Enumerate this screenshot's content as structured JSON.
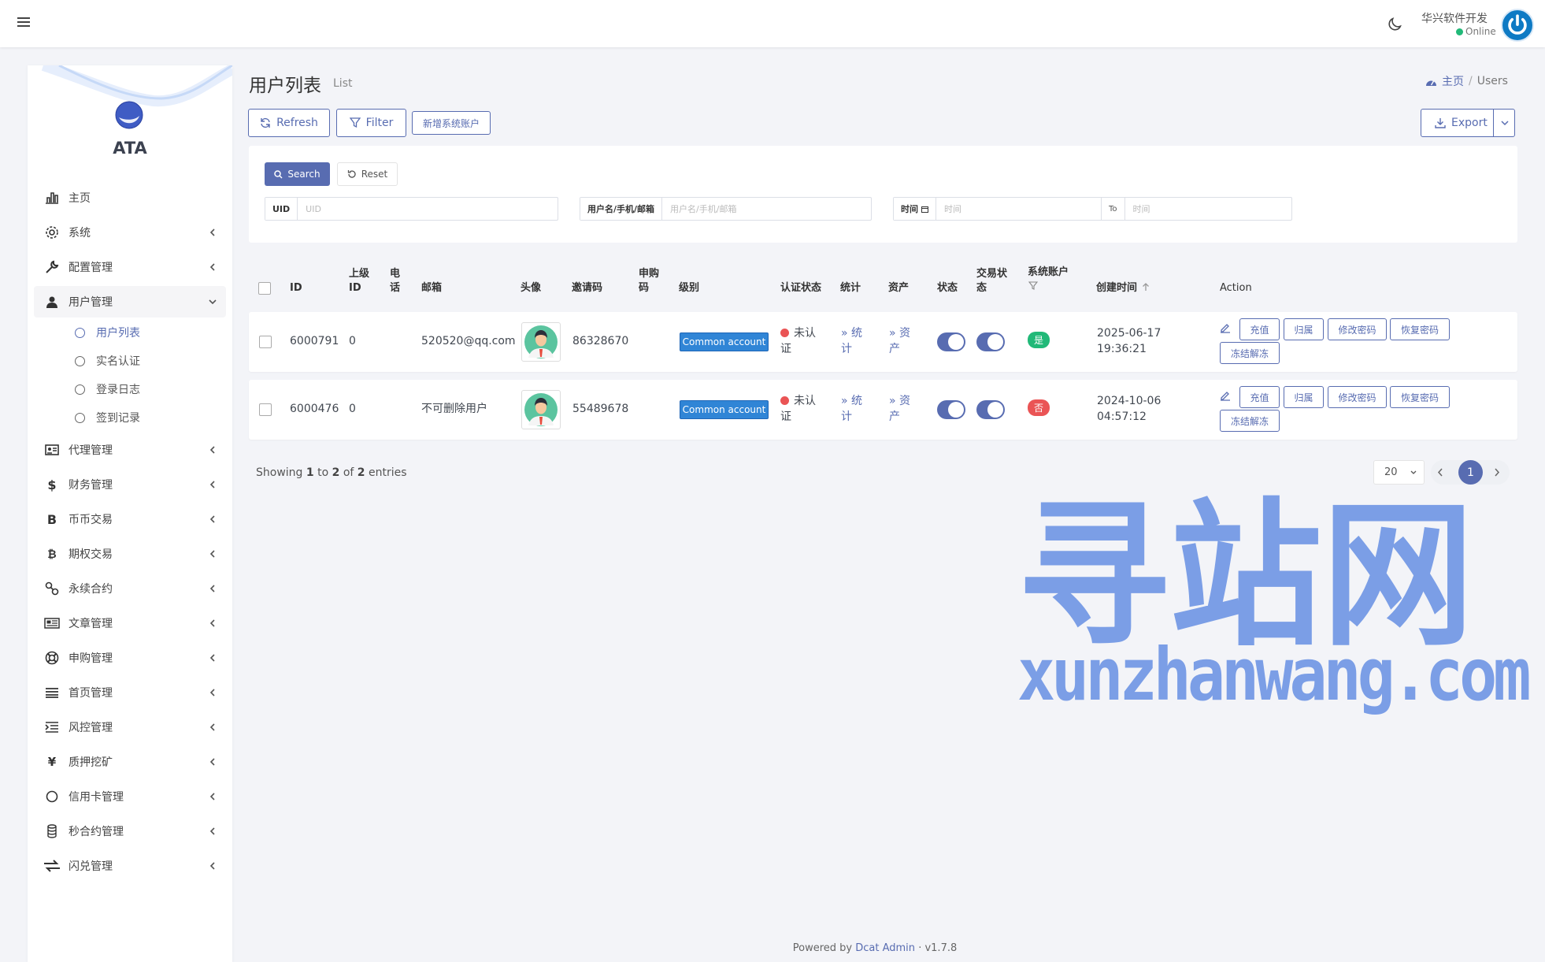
{
  "topbar": {
    "user_name": "华兴软件开发",
    "user_status": "Online"
  },
  "brand": {
    "name": "ATA"
  },
  "sidebar": {
    "items": [
      {
        "label": "主页",
        "icon": "bar-chart-icon"
      },
      {
        "label": "系统",
        "icon": "gear-icon"
      },
      {
        "label": "配置管理",
        "icon": "wrench-icon"
      },
      {
        "label": "用户管理",
        "icon": "user-secret-icon"
      },
      {
        "label": "代理管理",
        "icon": "id-card-icon"
      },
      {
        "label": "财务管理",
        "icon": "dollar-icon"
      },
      {
        "label": "币币交易",
        "icon": "bitcoin-b-icon"
      },
      {
        "label": "期权交易",
        "icon": "bitcoin-icon"
      },
      {
        "label": "永续合约",
        "icon": "link-icon"
      },
      {
        "label": "文章管理",
        "icon": "newspaper-icon"
      },
      {
        "label": "申购管理",
        "icon": "life-ring-icon"
      },
      {
        "label": "首页管理",
        "icon": "list-lines-icon"
      },
      {
        "label": "风控管理",
        "icon": "indent-icon"
      },
      {
        "label": "质押挖矿",
        "icon": "yen-icon"
      },
      {
        "label": "信用卡管理",
        "icon": "circle-icon"
      },
      {
        "label": "秒合约管理",
        "icon": "coins-icon"
      },
      {
        "label": "闪兑管理",
        "icon": "exchange-icon"
      }
    ],
    "sub_items": [
      {
        "label": "用户列表"
      },
      {
        "label": "实名认证"
      },
      {
        "label": "登录日志"
      },
      {
        "label": "签到记录"
      }
    ]
  },
  "page": {
    "title": "用户列表",
    "subtitle": "List"
  },
  "breadcrumb": {
    "home": "主页",
    "separator": "/",
    "current": "Users"
  },
  "toolbar": {
    "refresh": "Refresh",
    "filter": "Filter",
    "add_system": "新增系统账户",
    "export": "Export"
  },
  "filters": {
    "search": "Search",
    "reset": "Reset",
    "uid_label": "UID",
    "uid_placeholder": "UID",
    "user_label": "用户名/手机/邮箱",
    "user_placeholder": "用户名/手机/邮箱",
    "time_label": "时间",
    "time_placeholder": "时间",
    "to_label": "To",
    "to_placeholder": "时间"
  },
  "table": {
    "headers": {
      "id": "ID",
      "parent_id_1": "上级",
      "parent_id_2": "ID",
      "phone_1": "电",
      "phone_2": "话",
      "email": "邮箱",
      "avatar": "头像",
      "invite": "邀请码",
      "purchase_1": "申购",
      "purchase_2": "码",
      "level": "级别",
      "auth": "认证状态",
      "stats": "统计",
      "assets": "资产",
      "status": "状态",
      "trade_1": "交易状",
      "trade_2": "态",
      "sys_acct": "系统账户",
      "created": "创建时间",
      "action": "Action"
    },
    "rows": [
      {
        "id": "6000791",
        "parent_id": "0",
        "email": "520520@qq.com",
        "invite": "86328670",
        "level": "Common account",
        "auth_1": "未认",
        "auth_2": "证",
        "stats_1": "» 统",
        "stats_2": "计",
        "assets_1": "» 资",
        "assets_2": "产",
        "sys": "是",
        "date": "2025-06-17",
        "time": "19:36:21",
        "actions": {
          "recharge": "充值",
          "belong": "归属",
          "change_pwd": "修改密码",
          "restore_pwd": "恢复密码",
          "freeze": "冻结解冻"
        }
      },
      {
        "id": "6000476",
        "parent_id": "0",
        "email": "不可删除用户",
        "invite": "55489678",
        "level": "Common account",
        "auth_1": "未认",
        "auth_2": "证",
        "stats_1": "» 统",
        "stats_2": "计",
        "assets_1": "» 资",
        "assets_2": "产",
        "sys": "否",
        "date": "2024-10-06",
        "time": "04:57:12",
        "actions": {
          "recharge": "充值",
          "belong": "归属",
          "change_pwd": "修改密码",
          "restore_pwd": "恢复密码",
          "freeze": "冻结解冻"
        }
      }
    ]
  },
  "pagination": {
    "showing_prefix": "Showing",
    "from": "1",
    "to_word": "to",
    "to": "2",
    "of_word": "of",
    "total": "2",
    "entries": "entries",
    "per_page": "20",
    "current_page": "1"
  },
  "footer": {
    "powered": "Powered by",
    "link": "Dcat Admin",
    "sep": "·",
    "version": "v1.7.8"
  },
  "watermark": {
    "cn": "寻站网",
    "en": "xunzhanwang.com"
  },
  "colors": {
    "primary": "#586cb1",
    "success": "#21b978",
    "danger": "#ea5455",
    "badge_blue": "#3085d6"
  }
}
